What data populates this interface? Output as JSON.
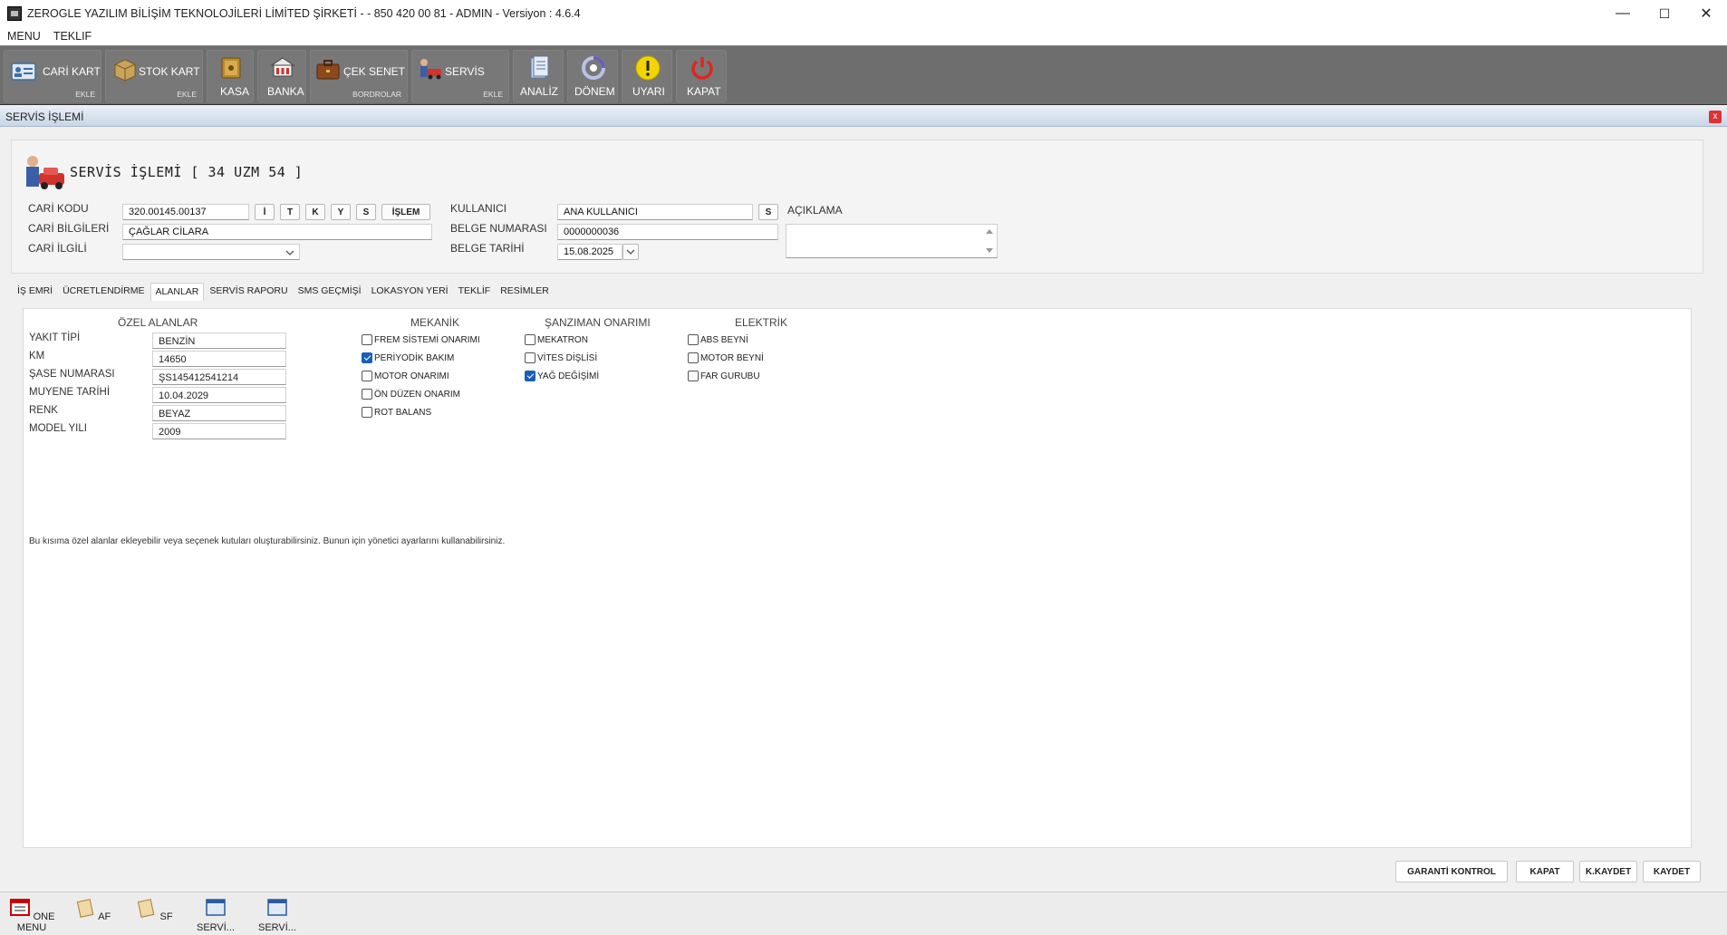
{
  "window": {
    "title": "ZEROGLE YAZILIM BİLİŞİM TEKNOLOJİLERİ LİMİTED ŞİRKETİ -  - 850 420 00 81 - ADMIN -  Versiyon : 4.6.4",
    "minimize": "—",
    "maximize": "☐",
    "close": "✕"
  },
  "menu": [
    "MENU",
    "TEKLIF"
  ],
  "toolbar": [
    {
      "label": "CARİ KART",
      "sub": "EKLE",
      "icon": "id-card-icon"
    },
    {
      "label": "STOK KART",
      "sub": "EKLE",
      "icon": "box-icon"
    },
    {
      "label": "KASA",
      "sub": "",
      "icon": "safe-icon"
    },
    {
      "label": "BANKA",
      "sub": "",
      "icon": "bank-icon"
    },
    {
      "label": "ÇEK SENET",
      "sub": "BORDROLAR",
      "icon": "briefcase-icon"
    },
    {
      "label": "SERVİS",
      "sub": "EKLE",
      "icon": "mechanic-car-icon"
    },
    {
      "label": "ANALİZ",
      "sub": "",
      "icon": "analysis-icon"
    },
    {
      "label": "DÖNEM",
      "sub": "",
      "icon": "cycle-icon"
    },
    {
      "label": "UYARI",
      "sub": "",
      "icon": "warning-icon"
    },
    {
      "label": "KAPAT",
      "sub": "",
      "icon": "power-icon"
    }
  ],
  "panel": {
    "title": "SERVİS İŞLEMİ",
    "close": "x",
    "heading": "SERVİS İŞLEMİ [ 34 UZM 54 ]"
  },
  "form": {
    "cari_kodu_label": "CARİ KODU",
    "cari_kodu": "320.00145.00137",
    "btn_i": "İ",
    "btn_t": "T",
    "btn_k": "K",
    "btn_y": "Y",
    "btn_s": "S",
    "btn_islem": "İŞLEM",
    "cari_bilgileri_label": "CARİ BİLGİLERİ",
    "cari_bilgileri": "ÇAĞLAR CİLARA",
    "cari_ilgili_label": "CARİ İLGİLİ",
    "cari_ilgili": "",
    "kullanici_label": "KULLANICI",
    "kullanici": "ANA KULLANICI",
    "kullanici_btn": "S",
    "belge_no_label": "BELGE NUMARASI",
    "belge_no": "0000000036",
    "belge_tarihi_label": "BELGE TARİHİ",
    "belge_tarihi": "15.08.2025",
    "aciklama_label": "AÇIKLAMA",
    "aciklama": ""
  },
  "tabs": [
    "İŞ EMRİ",
    "ÜCRETLENDİRME",
    "ALANLAR",
    "SERVİS RAPORU",
    "SMS GEÇMİŞİ",
    "LOKASYON YERİ",
    "TEKLİF",
    "RESİMLER"
  ],
  "active_tab": "ALANLAR",
  "ozel": {
    "title": "ÖZEL ALANLAR",
    "fields": [
      {
        "label": "YAKIT TİPİ",
        "value": "BENZİN"
      },
      {
        "label": "KM",
        "value": "14650"
      },
      {
        "label": "ŞASE NUMARASI",
        "value": "ŞS145412541214"
      },
      {
        "label": "MUYENE TARİHİ",
        "value": "10.04.2029"
      },
      {
        "label": "RENK",
        "value": "BEYAZ"
      },
      {
        "label": "MODEL YILI",
        "value": "2009"
      }
    ]
  },
  "groups": [
    {
      "title": "MEKANİK",
      "items": [
        {
          "label": "FREM SİSTEMİ ONARIMI",
          "checked": false
        },
        {
          "label": "PERİYODİK BAKIM",
          "checked": true
        },
        {
          "label": "MOTOR ONARIMI",
          "checked": false
        },
        {
          "label": "ÖN DÜZEN ONARIM",
          "checked": false
        },
        {
          "label": "ROT BALANS",
          "checked": false
        }
      ]
    },
    {
      "title": "ŞANZIMAN ONARIMI",
      "items": [
        {
          "label": "MEKATRON",
          "checked": false
        },
        {
          "label": "VİTES DİŞLİSİ",
          "checked": false
        },
        {
          "label": "YAĞ DEĞİŞİMİ",
          "checked": true
        }
      ]
    },
    {
      "title": "ELEKTRİK",
      "items": [
        {
          "label": "ABS BEYNİ",
          "checked": false
        },
        {
          "label": "MOTOR BEYNİ",
          "checked": false
        },
        {
          "label": "FAR GURUBU",
          "checked": false
        }
      ]
    }
  ],
  "info_text": "Bu kısıma özel alanlar ekleyebilir veya seçenek kutuları oluşturabilirsiniz. Bunun için yönetici ayarlarını kullanabilirsiniz.",
  "actions": [
    "GARANTİ KONTROL",
    "KAPAT",
    "K.KAYDET",
    "KAYDET"
  ],
  "taskbar": [
    "ONE MENU",
    "AF",
    "SF",
    "SERVİ...",
    "SERVİ..."
  ]
}
